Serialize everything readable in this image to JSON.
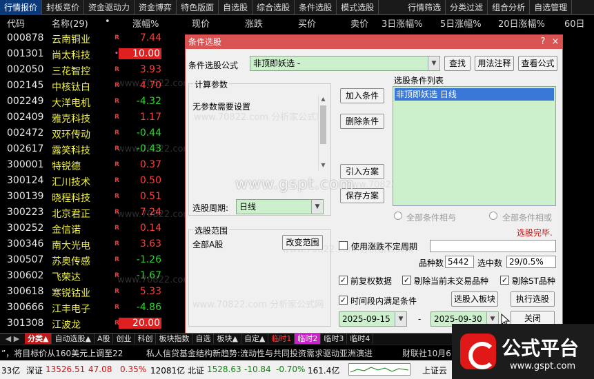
{
  "menu": [
    "行情报价",
    "封板竞价",
    "资金驱动力",
    "资金博弈",
    "特色版面",
    "自选股",
    "综合选股",
    "条件选股",
    "模式选股",
    "行情筛选",
    "分类过滤",
    "组合分析",
    "自选管理"
  ],
  "columns": {
    "code": "代码",
    "name": "名称(29)",
    "dot": "•",
    "pct": "涨幅%",
    "price": "现价",
    "change": "涨跌",
    "bid": "买价",
    "ask": "卖价",
    "d3": "3日涨幅%",
    "d5": "5日涨幅%",
    "d20": "20日涨幅%",
    "d60": "60日"
  },
  "stocks": [
    {
      "code": "000878",
      "name": "云南铜业",
      "pct": "7.44",
      "dir": "up",
      "mark": "R"
    },
    {
      "code": "001301",
      "name": "尚太科技",
      "pct": "10.00",
      "dir": "limit",
      "mark": "•"
    },
    {
      "code": "002050",
      "name": "三花智控",
      "pct": "3.93",
      "dir": "up",
      "mark": "R"
    },
    {
      "code": "002145",
      "name": "中核钛白",
      "pct": "4.70",
      "dir": "up",
      "mark": "R"
    },
    {
      "code": "002249",
      "name": "大洋电机",
      "pct": "-4.32",
      "dir": "down",
      "mark": "R"
    },
    {
      "code": "002409",
      "name": "雅克科技",
      "pct": "1.17",
      "dir": "up",
      "mark": "R"
    },
    {
      "code": "002472",
      "name": "双环传动",
      "pct": "-0.44",
      "dir": "down",
      "mark": "R"
    },
    {
      "code": "002617",
      "name": "露笑科技",
      "pct": "-0.43",
      "dir": "down",
      "mark": "R"
    },
    {
      "code": "300001",
      "name": "特锐德",
      "pct": "0.37",
      "dir": "up",
      "mark": "R"
    },
    {
      "code": "300124",
      "name": "汇川技术",
      "pct": "0.50",
      "dir": "up",
      "mark": "R"
    },
    {
      "code": "300139",
      "name": "晓程科技",
      "pct": "0.51",
      "dir": "up",
      "mark": "R"
    },
    {
      "code": "300223",
      "name": "北京君正",
      "pct": "7.24",
      "dir": "up",
      "mark": "R"
    },
    {
      "code": "300252",
      "name": "金信诺",
      "pct": "0.14",
      "dir": "up",
      "mark": "R"
    },
    {
      "code": "300346",
      "name": "南大光电",
      "pct": "3.63",
      "dir": "up",
      "mark": "R"
    },
    {
      "code": "300507",
      "name": "苏奥传感",
      "pct": "-1.26",
      "dir": "down",
      "mark": "R"
    },
    {
      "code": "300602",
      "name": "飞荣达",
      "pct": "-1.67",
      "dir": "down",
      "mark": "R"
    },
    {
      "code": "300618",
      "name": "寒锐钴业",
      "pct": "5.33",
      "dir": "up",
      "mark": "R"
    },
    {
      "code": "300666",
      "name": "江丰电子",
      "pct": "-4.86",
      "dir": "down",
      "mark": "R"
    },
    {
      "code": "301308",
      "name": "江波龙",
      "pct": "20.00",
      "dir": "limit",
      "mark": "R"
    }
  ],
  "tabs": [
    {
      "label": "分类▲",
      "style": "active"
    },
    {
      "label": "自动选股▲",
      "style": ""
    },
    {
      "label": "A股",
      "style": ""
    },
    {
      "label": "创业",
      "style": ""
    },
    {
      "label": "科创",
      "style": ""
    },
    {
      "label": "板块指数",
      "style": ""
    },
    {
      "label": "自选",
      "style": ""
    },
    {
      "label": "板块▲",
      "style": ""
    },
    {
      "label": "自定▲",
      "style": ""
    },
    {
      "label": "临时1",
      "style": "hot"
    },
    {
      "label": "临时2",
      "style": "hot2"
    },
    {
      "label": "临时3",
      "style": ""
    },
    {
      "label": "临时4",
      "style": ""
    }
  ],
  "ticker": {
    "t1": "”，将目标价从160美元上调至22",
    "t2": "私人信贷基金结构新趋势:流动性与共同投资需求驱动亚洲演进",
    "t3": "财联社10月6"
  },
  "status": {
    "s0": "33亿",
    "sz_label": "深证",
    "sz_val": "13526.51",
    "sz_chg": "47.08",
    "sz_pct": "0.35%",
    "sz_amt": "12081亿",
    "bz_label": "北证",
    "bz_val": "1528.63",
    "bz_chg": "-10.84",
    "bz_pct": "-0.70%",
    "bz_amt": "161.4亿",
    "sh_label": "上证云"
  },
  "dialog": {
    "title": "条件选股",
    "formula_label": "条件选股公式",
    "formula_value": "非顶即妖选  -",
    "btn_find": "查找",
    "btn_usage": "用法注释",
    "btn_view": "查看公式",
    "params_label": "计算参数",
    "params_text": "无参数需要设置",
    "period_label": "选股周期:",
    "period_value": "日线",
    "range_label": "选股范围",
    "range_value": "全部A股",
    "btn_change_range": "改变范围",
    "btn_add": "加入条件",
    "btn_delete": "删除条件",
    "btn_import": "引入方案",
    "btn_save": "保存方案",
    "list_label": "选股条件列表",
    "list_item": "非顶即妖选  日线",
    "radio_and": "全部条件相与",
    "radio_or": "全部条件相或",
    "done_text": "选股完毕.",
    "chk_variable": "使用涨跌不定周期",
    "count_label": "品种数",
    "count_value": "5442",
    "selected_label": "选中数",
    "selected_value": "29/0.5%",
    "chk_prerestore": "前复权数据",
    "chk_remove_untraded": "剔除当前未交易品种",
    "chk_remove_st": "剔除ST品种",
    "chk_period": "时间段内满足条件",
    "btn_to_block": "选股入板块",
    "btn_execute": "执行选股",
    "date_from": "2025-09-15",
    "date_sep": "-",
    "date_to": "2025-09-30",
    "btn_close": "关闭",
    "close_icon": "×",
    "help_icon": "?",
    "watermark_big": "www.gspt.com"
  },
  "watermarks": [
    "www.70822.com 分析家公式网",
    "www.70822.com 分析家公式网",
    "www.70822.com 分析家公式网",
    "www.70822.com 分析家公式网",
    "www.70822.com 分析家公式网",
    "www.70822.com 分析家公式网",
    "www.70822.com 分析家公式网",
    "www.70822.com 分析家公式网"
  ],
  "logo": {
    "text": "公式平台",
    "url": "www.gspt.com"
  },
  "colors": {
    "up": "#ff3c3c",
    "down": "#2ad62a",
    "dialogTitle": "#d95353",
    "listBg": "#ccf0cc",
    "selection": "#3a78d8",
    "limitBg": "#e02020"
  }
}
